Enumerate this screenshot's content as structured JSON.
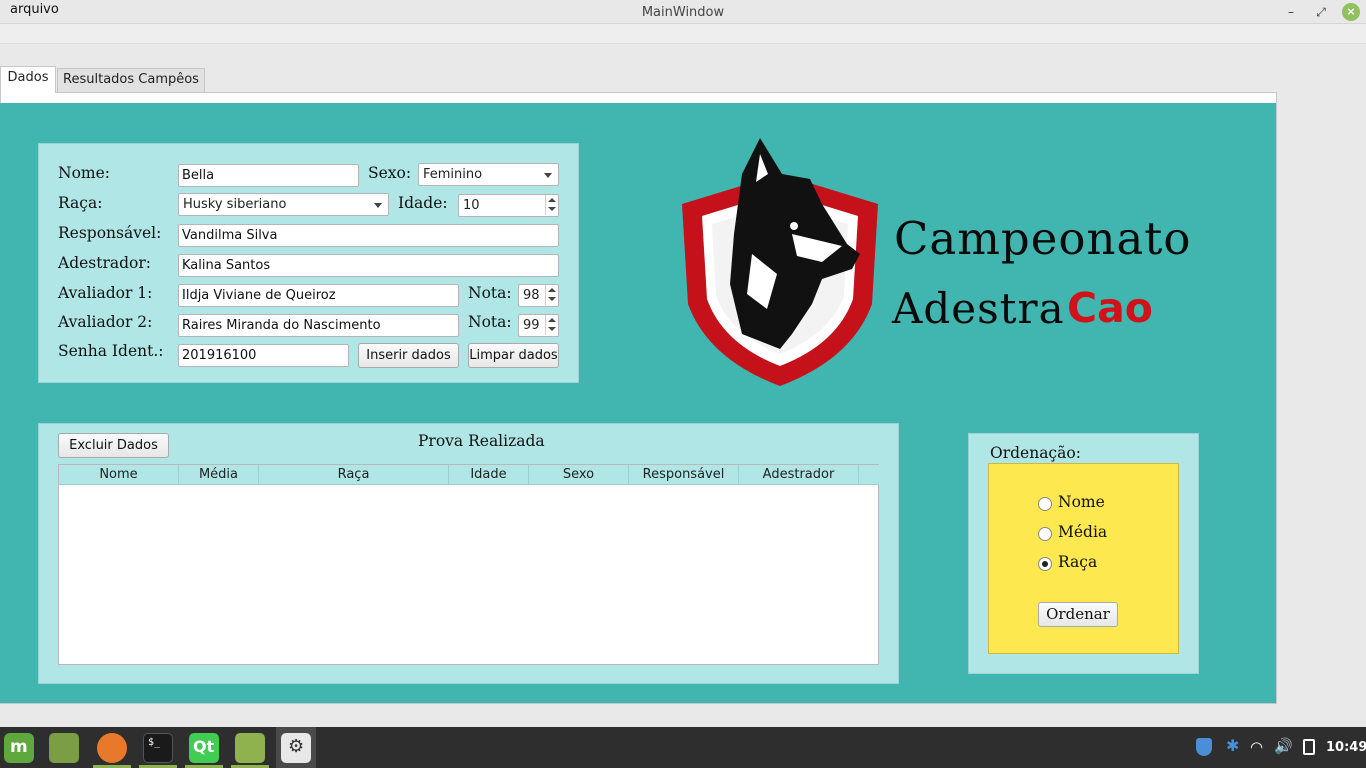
{
  "window": {
    "title": "MainWindow",
    "controls": {
      "minimize": "–",
      "restore": "⤢",
      "close": "×"
    }
  },
  "menu": {
    "items": [
      "arquivo"
    ]
  },
  "tabs": [
    {
      "label": "Dados",
      "active": true
    },
    {
      "label": "Resultados Campêos",
      "active": false
    }
  ],
  "colors": {
    "background": "#41b6b0",
    "panel": "#b0e7e6",
    "sort_box": "#fde84f",
    "logo_red": "#d0131b"
  },
  "form": {
    "nome_label": "Nome:",
    "nome_value": "Bella",
    "sexo_label": "Sexo:",
    "sexo_value": "Feminino",
    "raca_label": "Raça:",
    "raca_value": "Husky siberiano",
    "idade_label": "Idade:",
    "idade_value": "10",
    "responsavel_label": "Responsável:",
    "responsavel_value": "Vandilma Silva",
    "adestrador_label": "Adestrador:",
    "adestrador_value": "Kalina Santos",
    "avaliador1_label": "Avaliador 1:",
    "avaliador1_value": "Ildja Viviane de Queiroz",
    "nota1_label": "Nota:",
    "nota1_value": "98",
    "avaliador2_label": "Avaliador 2:",
    "avaliador2_value": "Raires Miranda do Nascimento",
    "nota2_label": "Nota:",
    "nota2_value": "99",
    "senha_label": "Senha Ident.:",
    "senha_value": "201916100",
    "inserir_button": "Inserir dados",
    "limpar_button": "Limpar dados"
  },
  "logo": {
    "line1": "Campeonato",
    "line2_black": "Adestra",
    "line2_red": "Cao"
  },
  "results": {
    "excluir_button": "Excluir Dados",
    "title": "Prova Realizada",
    "columns": [
      "Nome",
      "Média",
      "Raça",
      "Idade",
      "Sexo",
      "Responsável",
      "Adestrador"
    ]
  },
  "sort": {
    "title": "Ordenação:",
    "options": [
      {
        "label": "Nome",
        "checked": false
      },
      {
        "label": "Média",
        "checked": false
      },
      {
        "label": "Raça",
        "checked": true
      }
    ],
    "button": "Ordenar"
  },
  "taskbar": {
    "apps": [
      "mint-menu-icon",
      "show-desktop-icon",
      "firefox-icon",
      "terminal-icon",
      "qt-creator-icon",
      "files-icon",
      "settings-icon"
    ],
    "tray": [
      "shield-icon",
      "bluetooth-icon",
      "wifi-icon",
      "volume-icon",
      "clipboard-icon"
    ],
    "clock": "10:49"
  }
}
